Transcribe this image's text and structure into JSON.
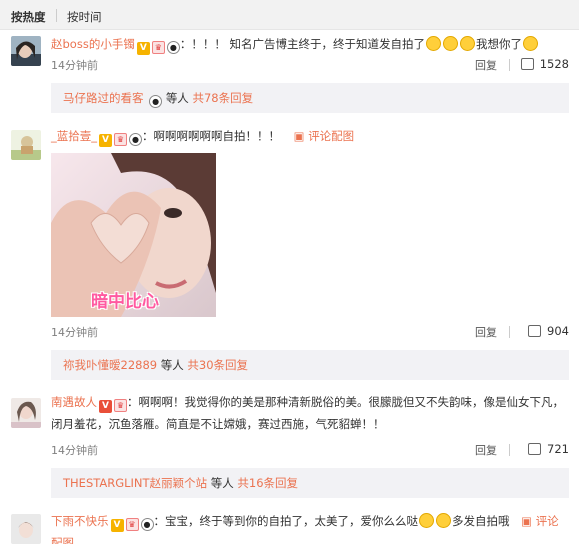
{
  "sort": {
    "hot": "按热度",
    "time": "按时间"
  },
  "comments": [
    {
      "user": "赵boss的小手镯",
      "text_a": "：！！！ 知名广告博主终于，终于知道发自拍了",
      "text_b": "我想你了",
      "time": "14分钟前",
      "reply": "回复",
      "likes": "1528",
      "sub_user": "马仔路过的看客",
      "sub_mid": "等人",
      "sub_count": "共78条回复"
    },
    {
      "user": "_蓝拾壹_",
      "text_a": "：啊啊啊啊啊啊自拍！！！",
      "img_link": "评论配图",
      "img_caption": "暗中比心",
      "time": "14分钟前",
      "reply": "回复",
      "likes": "904",
      "sub_user": "祢我卟懂暧22889",
      "sub_mid": "等人",
      "sub_count": "共30条回复"
    },
    {
      "user": "南遇故人",
      "text_a": "：啊啊啊！我觉得你的美是那种清新脱俗的美。很朦胧但又不失韵味，像是仙女下凡，闭月羞花，沉鱼落雁。简直是不让嫦娥，赛过西施，气死貂蝉！！",
      "time": "14分钟前",
      "reply": "回复",
      "likes": "721",
      "sub_user": "THESTARGLINT赵丽颖个站",
      "sub_mid": "等人",
      "sub_count": "共16条回复"
    },
    {
      "user": "下雨不快乐",
      "text_a": "：宝宝，终于等到你的自拍了，太美了，爱你么么哒",
      "text_b": "多发自拍哦",
      "img_link": "评论配图"
    }
  ]
}
